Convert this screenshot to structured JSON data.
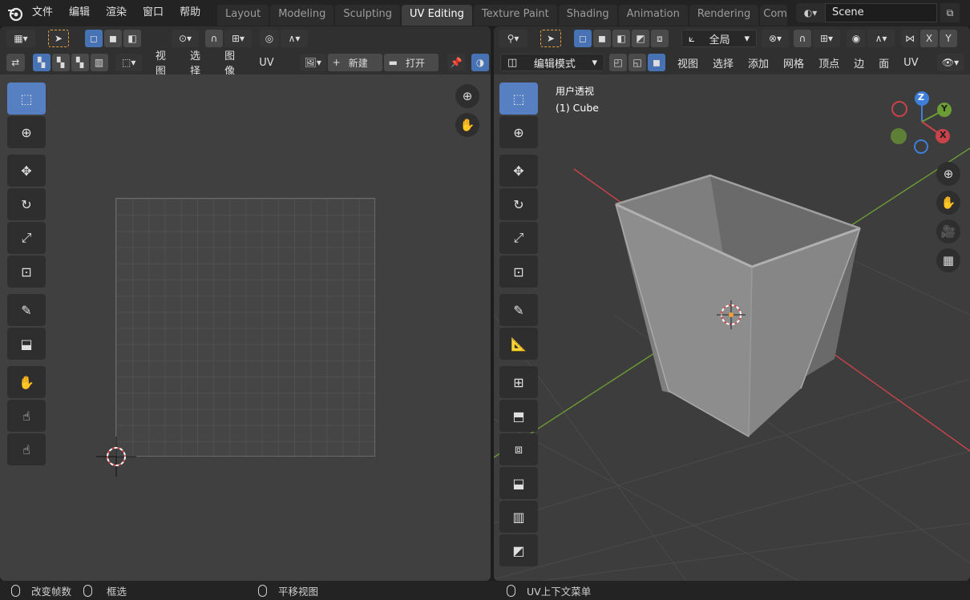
{
  "menu": [
    "文件",
    "编辑",
    "渲染",
    "窗口",
    "帮助"
  ],
  "workspace_tabs": [
    {
      "label": "Layout",
      "active": false
    },
    {
      "label": "Modeling",
      "active": false
    },
    {
      "label": "Sculpting",
      "active": false
    },
    {
      "label": "UV Editing",
      "active": true
    },
    {
      "label": "Texture Paint",
      "active": false
    },
    {
      "label": "Shading",
      "active": false
    },
    {
      "label": "Animation",
      "active": false
    },
    {
      "label": "Rendering",
      "active": false
    },
    {
      "label": "Com",
      "active": false
    }
  ],
  "scene": {
    "name": "Scene"
  },
  "uv_editor": {
    "menus": [
      "视图",
      "选择",
      "图像",
      "UV"
    ],
    "new_label": "新建",
    "open_label": "打开"
  },
  "viewport": {
    "mode": "编辑模式",
    "transform_orientation": "全局",
    "menus": [
      "视图",
      "选择",
      "添加",
      "网格",
      "顶点",
      "边",
      "面",
      "UV"
    ],
    "axes": [
      "X",
      "Y"
    ],
    "view_name": "用户透视",
    "object_name": "(1) Cube",
    "gizmo": {
      "x": "X",
      "y": "Y",
      "z": "Z"
    }
  },
  "status": {
    "item1": "改变帧数",
    "item2": "框选",
    "item3": "平移视图",
    "item4": "UV上下文菜单"
  },
  "colors": {
    "accent": "#4772b3",
    "x_axis": "#c8434a",
    "y_axis": "#6c9c34",
    "z_axis": "#3d7fd9"
  }
}
